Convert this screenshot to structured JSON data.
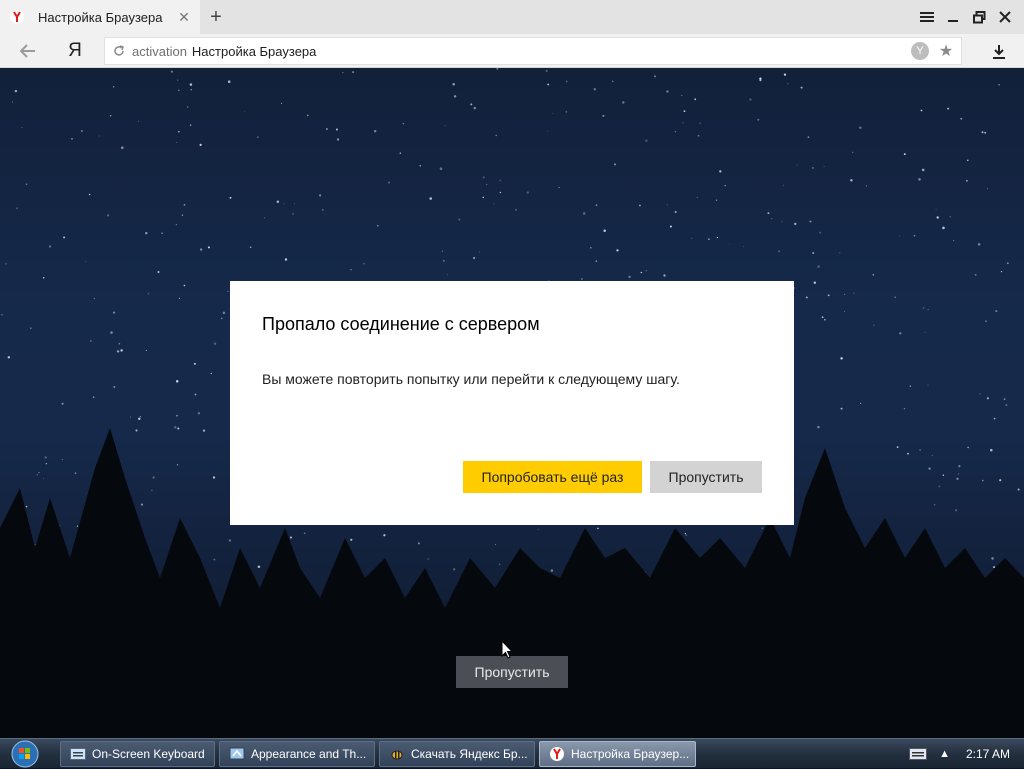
{
  "browser": {
    "tab": {
      "title": "Настройка Браузера",
      "favicon": "yandex-icon"
    },
    "new_tab_icon": "plus-icon",
    "window_controls": [
      "menu-icon",
      "minimize-icon",
      "restore-icon",
      "close-icon"
    ],
    "toolbar": {
      "back_icon": "back-arrow-icon",
      "yandex_button": "Я",
      "address": {
        "host": "activation",
        "title": "Настройка Браузера"
      },
      "protect_icon": "protect-icon",
      "bookmark_icon": "star-icon",
      "download_icon": "download-icon"
    }
  },
  "dialog": {
    "title": "Пропало соединение с сервером",
    "message": "Вы можете повторить попытку или перейти к следующему шагу.",
    "retry_label": "Попробовать ещё раз",
    "skip_label": "Пропустить"
  },
  "page": {
    "background_skip_label": "Пропустить"
  },
  "taskbar": {
    "items": [
      {
        "label": "On-Screen Keyboard",
        "icon": "keyboard-icon",
        "active": false
      },
      {
        "label": "Appearance and Th...",
        "icon": "control-panel-icon",
        "active": false
      },
      {
        "label": "Скачать Яндекс Бр...",
        "icon": "bee-icon",
        "active": false
      },
      {
        "label": "Настройка Браузер...",
        "icon": "yandex-icon",
        "active": true
      }
    ],
    "clock": "2:17 AM"
  },
  "colors": {
    "accent": "#ffcc00",
    "secondary_button": "#d3d3d3"
  }
}
